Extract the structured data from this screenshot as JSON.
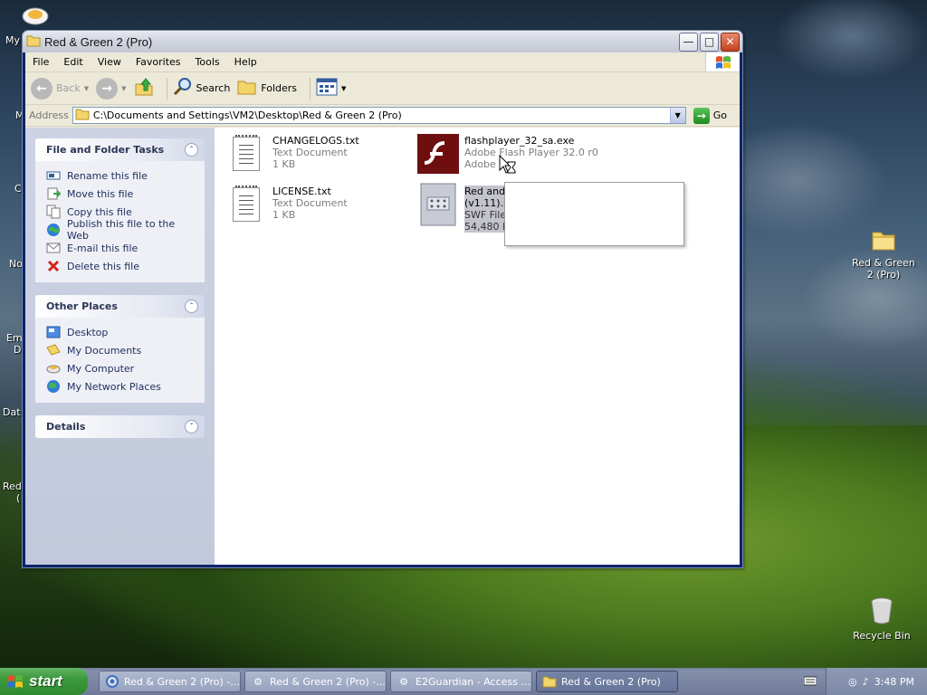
{
  "desktop": {
    "icons": [
      {
        "name": "Red & Green 2\n(Pro)",
        "label": "Red & Green 2 (Pro)"
      },
      {
        "name": "Recycle Bin",
        "label": "Recycle Bin"
      }
    ],
    "edge_labels": [
      "My",
      "M",
      "C",
      "No",
      "Em",
      "D",
      "Dat",
      "Red",
      "("
    ]
  },
  "window": {
    "title": "Red & Green 2 (Pro)",
    "menu": [
      "File",
      "Edit",
      "View",
      "Favorites",
      "Tools",
      "Help"
    ],
    "toolbar": {
      "back": "Back",
      "search": "Search",
      "folders": "Folders"
    },
    "address": {
      "label": "Address",
      "value": "C:\\Documents and Settings\\VM2\\Desktop\\Red & Green 2 (Pro)",
      "go": "Go"
    },
    "taskpane": {
      "file_tasks": {
        "title": "File and Folder Tasks",
        "items": [
          "Rename this file",
          "Move this file",
          "Copy this file",
          "Publish this file to the Web",
          "E-mail this file",
          "Delete this file"
        ]
      },
      "other_places": {
        "title": "Other Places",
        "items": [
          "Desktop",
          "My Documents",
          "My Computer",
          "My Network Places"
        ]
      },
      "details": {
        "title": "Details"
      }
    },
    "files": [
      {
        "name": "CHANGELOGS.txt",
        "type": "Text Document",
        "size": "1 KB"
      },
      {
        "name": "flashplayer_32_sa.exe",
        "type": "Adobe Flash Player 32.0 r0",
        "size": "Adobe"
      },
      {
        "name": "LICENSE.txt",
        "type": "Text Document",
        "size": "1 KB"
      },
      {
        "name": "Red and Green 2 (v1.11).swf",
        "type": "SWF File",
        "size": "54,480 KB"
      }
    ]
  },
  "taskbar": {
    "start": "start",
    "buttons": [
      {
        "label": "Red & Green 2 (Pro) -..."
      },
      {
        "label": "Red & Green 2 (Pro) -..."
      },
      {
        "label": "E2Guardian - Access ..."
      },
      {
        "label": "Red & Green 2 (Pro)"
      }
    ],
    "clock": "3:48 PM"
  },
  "colors": {
    "selection": "#c2c3cc",
    "taskpane_text": "#1f2c5c",
    "start_green": "#3c9a3c"
  }
}
